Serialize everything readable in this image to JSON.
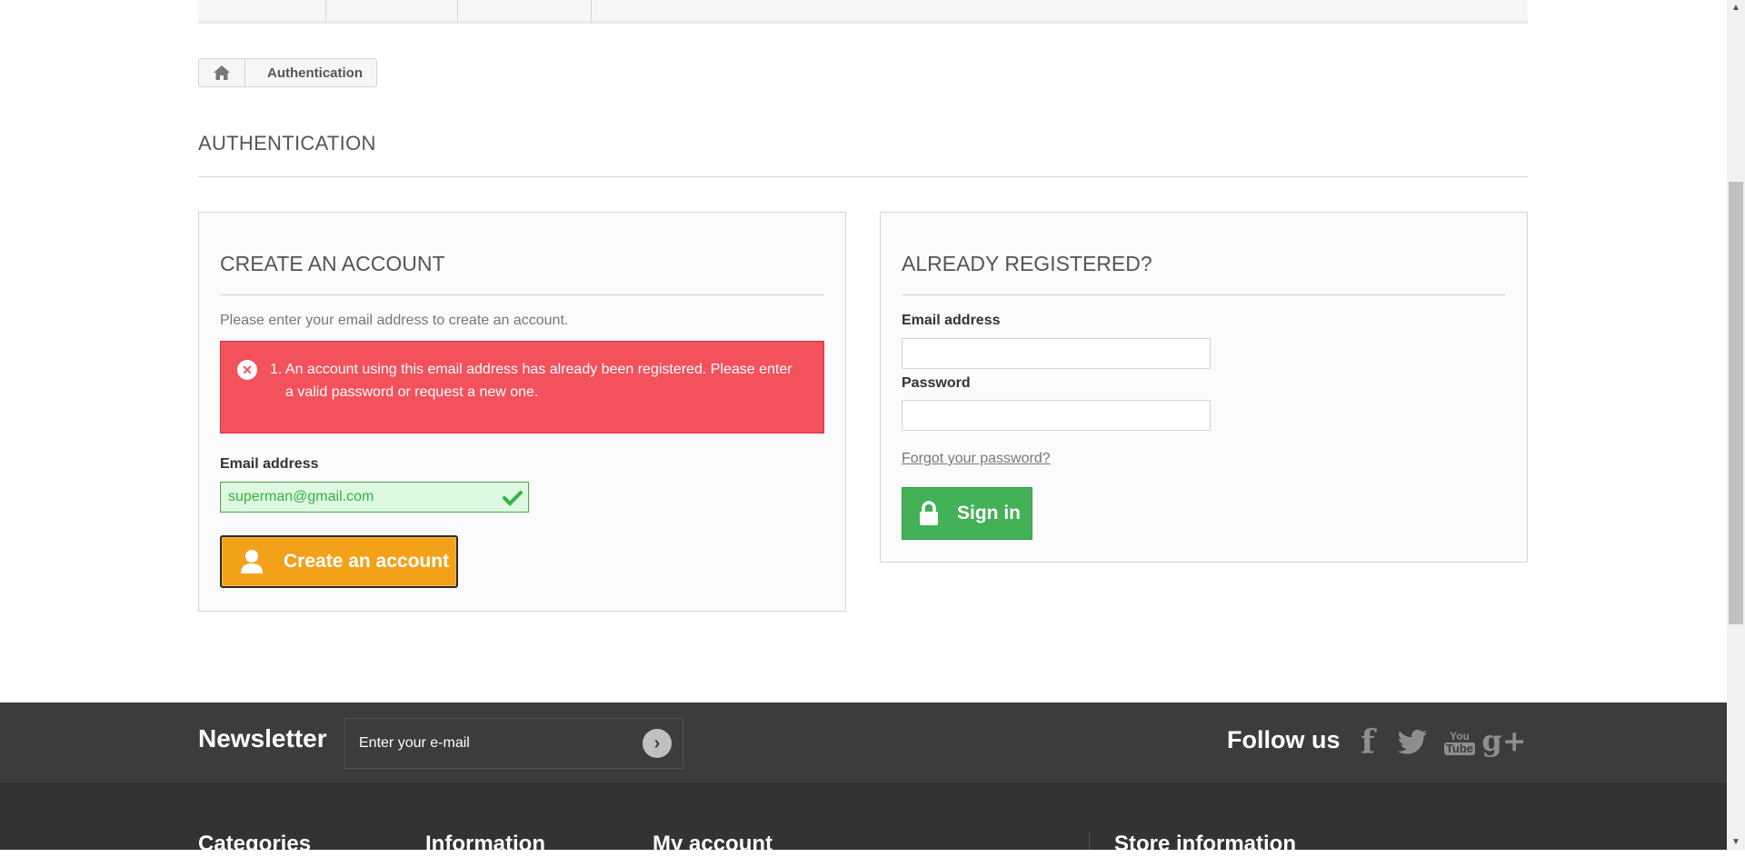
{
  "breadcrumb": {
    "home_icon": "home-icon",
    "current": "Authentication"
  },
  "page_title": "AUTHENTICATION",
  "create_account": {
    "title": "CREATE AN ACCOUNT",
    "hint": "Please enter your email address to create an account.",
    "error": {
      "icon": "error-circle-icon",
      "line1": "1. An account using this email address has already been registered. Please enter",
      "line2": "a valid password or request a new one."
    },
    "email_label": "Email address",
    "email_value": "superman@gmail.com",
    "button_label": "Create an account",
    "colors": {
      "button": "#f4a11a",
      "error": "#f3515c",
      "valid": "#35b33f"
    }
  },
  "login": {
    "title": "ALREADY REGISTERED?",
    "email_label": "Email address",
    "email_value": "",
    "password_label": "Password",
    "password_value": "",
    "forgot_label": "Forgot your password?",
    "button_label": "Sign in",
    "colors": {
      "button": "#43b155"
    }
  },
  "footer": {
    "newsletter_title": "Newsletter",
    "newsletter_placeholder": "Enter your e-mail",
    "follow_title": "Follow us",
    "social": [
      "facebook-icon",
      "twitter-icon",
      "youtube-icon",
      "google-plus-icon"
    ],
    "social_glyphs": {
      "facebook": "f",
      "youtube_top": "You",
      "youtube_bottom": "Tube",
      "google": "g+"
    },
    "columns": [
      "Categories",
      "Information",
      "My account",
      "Store information"
    ]
  }
}
